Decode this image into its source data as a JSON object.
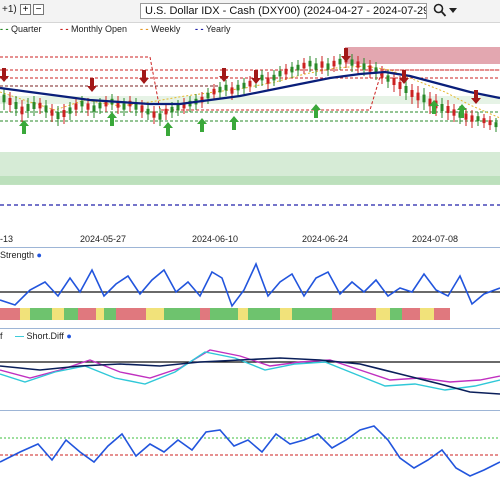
{
  "toolbar": {
    "fragment": "+1)",
    "plus_label": "+",
    "minus_label": "−",
    "symbol_text": "U.S. Dollar IDX - Cash (DXY00) (2024-04-27 - 2024-07-29)"
  },
  "legend": [
    {
      "label": "Quarter",
      "color": "#2a8a2a"
    },
    {
      "label": "Monthly Open",
      "color": "#cc2222"
    },
    {
      "label": "Weekly",
      "color": "#e59a2a"
    },
    {
      "label": "Yearly",
      "color": "#2222aa"
    }
  ],
  "x_axis": {
    "labels": [
      "-13",
      "2024-05-27",
      "2024-06-10",
      "2024-06-24",
      "2024-07-08"
    ]
  },
  "panels": {
    "strength_label": "Strength",
    "diff_label_left": "f",
    "diff_label_right": "Short.Diff"
  },
  "colors": {
    "up_candle": "#2a8a2a",
    "down_candle": "#cc2222",
    "moving_average": "#0a1f7a",
    "weekly_line": "#e5b82a",
    "up_arrow": "#3aa83a",
    "down_arrow": "#a21818",
    "indicator_line": "#2255dd",
    "diff_magenta": "#c030c0",
    "diff_cyan": "#30c8d8",
    "diff_navy": "#0a1f5a"
  }
}
